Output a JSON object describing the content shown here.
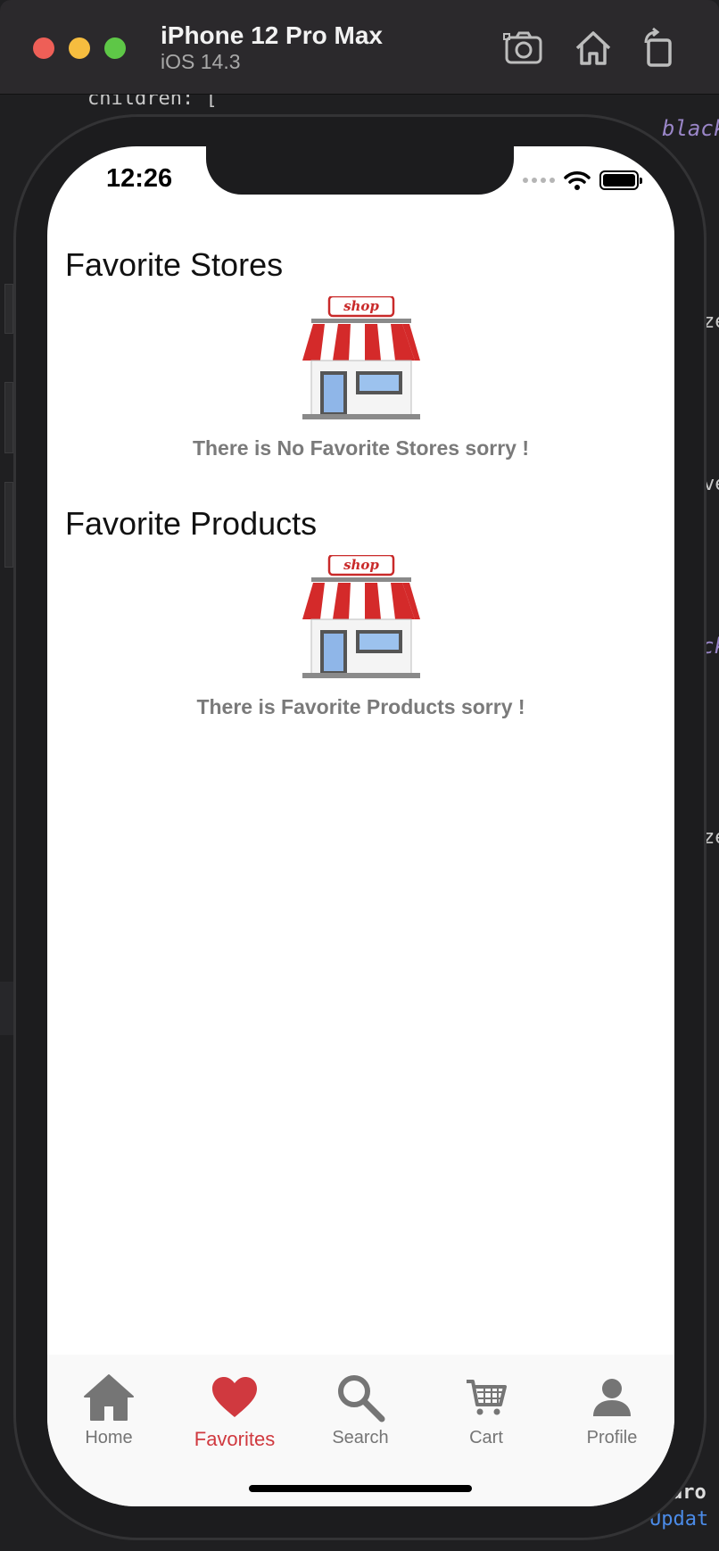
{
  "window": {
    "device_name": "iPhone 12 Pro Max",
    "os_version": "iOS 14.3",
    "toolbar_icons": [
      "screenshot-icon",
      "home-icon",
      "rotate-icon"
    ]
  },
  "editor": {
    "line_children": "children: [",
    "kw_black_1": "black",
    "frag_ze_1": "ze",
    "frag_ve": "ve",
    "frag_ck": "ck",
    "frag_ze_2": "ze",
    "frag_dro": "dro",
    "frag_updat": "Updat"
  },
  "status_bar": {
    "time": "12:26"
  },
  "favorites": {
    "stores": {
      "title": "Favorite Stores",
      "empty_message": "There is No Favorite Stores sorry !",
      "image_label": "shop"
    },
    "products": {
      "title": "Favorite Products",
      "empty_message": "There is Favorite Products sorry !",
      "image_label": "shop"
    }
  },
  "tabbar": {
    "active": "Favorites",
    "items": [
      {
        "label": "Home",
        "icon": "home-icon"
      },
      {
        "label": "Favorites",
        "icon": "heart-icon"
      },
      {
        "label": "Search",
        "icon": "search-icon"
      },
      {
        "label": "Cart",
        "icon": "cart-icon"
      },
      {
        "label": "Profile",
        "icon": "profile-icon"
      }
    ]
  },
  "colors": {
    "accent": "#d0393f",
    "inactive_tab": "#757575",
    "message_text": "#7a7a7a"
  }
}
